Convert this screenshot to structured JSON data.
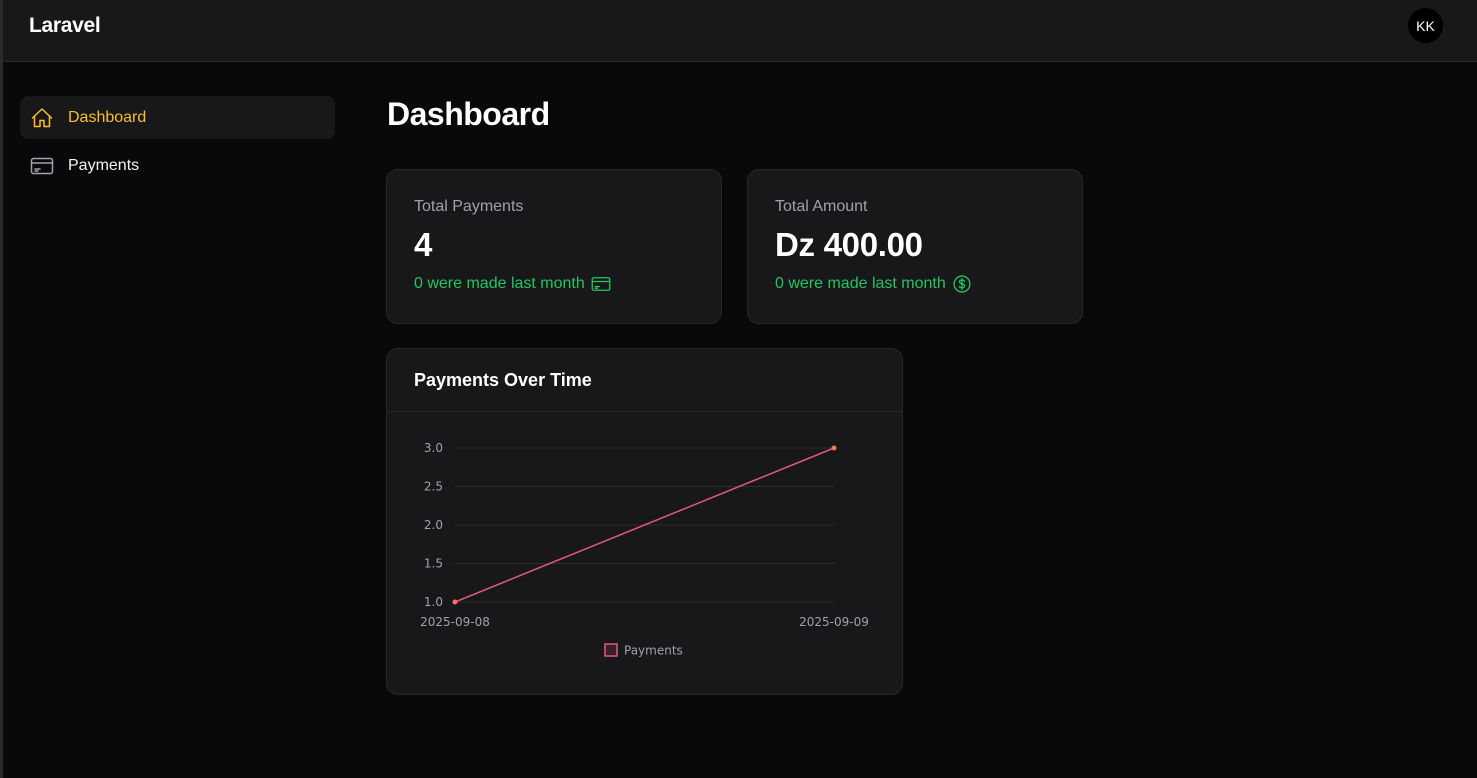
{
  "header": {
    "brand": "Laravel",
    "avatar_initials": "KK"
  },
  "sidebar": {
    "items": [
      {
        "label": "Dashboard",
        "icon": "home-icon",
        "active": true
      },
      {
        "label": "Payments",
        "icon": "credit-card-icon",
        "active": false
      }
    ]
  },
  "main": {
    "title": "Dashboard",
    "stats": [
      {
        "label": "Total Payments",
        "value": "4",
        "description": "0 were made last month",
        "icon": "credit-card-icon"
      },
      {
        "label": "Total Amount",
        "value": "Dz 400.00",
        "description": "0 were made last month",
        "icon": "dollar-circle-icon"
      }
    ],
    "chart_card": {
      "title": "Payments Over Time"
    }
  },
  "colors": {
    "accent": "#fbbf24",
    "success": "#22c55e",
    "line": "#e4587a",
    "point": "#f97360"
  },
  "chart_data": {
    "type": "line",
    "x": [
      "2025-09-08",
      "2025-09-09"
    ],
    "series": [
      {
        "name": "Payments",
        "values": [
          1,
          3
        ]
      }
    ],
    "ylim": [
      1,
      3
    ],
    "yticks": [
      "1.0",
      "1.5",
      "2.0",
      "2.5",
      "3.0"
    ],
    "grid": true,
    "legend": "bottom"
  }
}
